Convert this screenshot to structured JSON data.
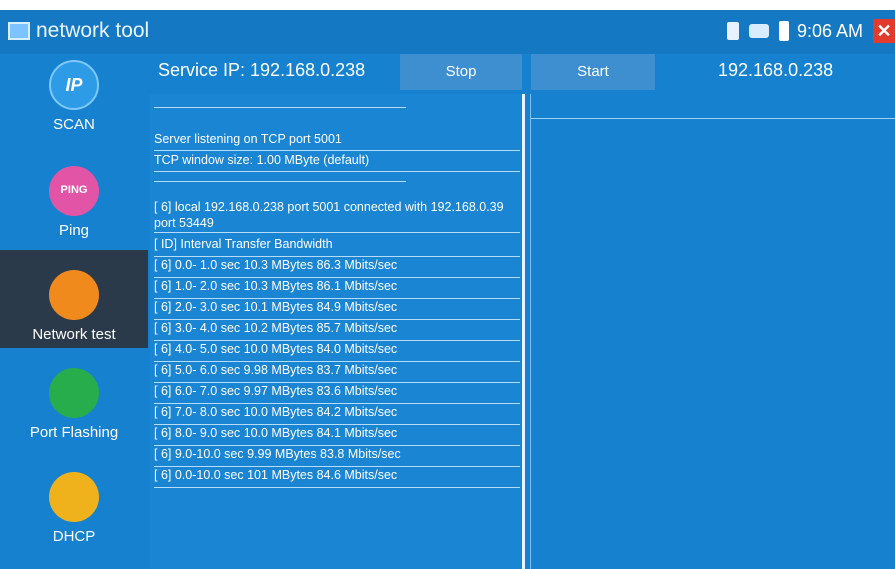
{
  "titlebar": {
    "app_name": "network tool",
    "time": "9:06 AM",
    "close_glyph": "✕",
    "icons": [
      "sim-card-icon",
      "network-icon",
      "battery-icon",
      "close-icon"
    ]
  },
  "sidebar": {
    "items": [
      {
        "label": "SCAN",
        "icon": "ip-scan-icon",
        "glyph": "IP"
      },
      {
        "label": "Ping",
        "icon": "ping-icon",
        "glyph": "PING"
      },
      {
        "label": "Network test",
        "icon": "network-test-icon",
        "glyph": ""
      },
      {
        "label": "Port Flashing",
        "icon": "port-flashing-icon",
        "glyph": ""
      },
      {
        "label": "DHCP",
        "icon": "dhcp-icon",
        "glyph": ""
      }
    ],
    "active": "Network test"
  },
  "header": {
    "service_ip": "Service IP: 192.168.0.238",
    "stop_label": "Stop",
    "start_label": "Start",
    "server_ip": "192.168.0.238"
  },
  "log": {
    "lines": [
      "Server listening on TCP port 5001",
      "TCP window size: 1.00 MByte (default)",
      "[ 6] local 192.168.0.238 port 5001 connected with 192.168.0.39 port 53449",
      "[ ID] Interval      Transfer    Bandwidth",
      "[ 6]  0.0- 1.0 sec  10.3 MBytes  86.3 Mbits/sec",
      "[ 6]  1.0- 2.0 sec  10.3 MBytes  86.1 Mbits/sec",
      "[ 6]  2.0- 3.0 sec  10.1 MBytes  84.9 Mbits/sec",
      "[ 6]  3.0- 4.0 sec  10.2 MBytes  85.7 Mbits/sec",
      "[ 6]  4.0- 5.0 sec  10.0 MBytes  84.0 Mbits/sec",
      "[ 6]  5.0- 6.0 sec  9.98 MBytes  83.7 Mbits/sec",
      "[ 6]  6.0- 7.0 sec  9.97 MBytes  83.6 Mbits/sec",
      "[ 6]  7.0- 8.0 sec  10.0 MBytes  84.2 Mbits/sec",
      "[ 6]  8.0- 9.0 sec  10.0 MBytes  84.1 Mbits/sec",
      "[ 6]  9.0-10.0 sec  9.99 MBytes  83.8 Mbits/sec",
      "[ 6]  0.0-10.0 sec  101 MBytes  84.6 Mbits/sec"
    ]
  },
  "colors": {
    "background": "#1682cf",
    "titlebar": "#1478c2",
    "active_nav": "#2b3a4a",
    "button": "#3d8fcf",
    "close": "#e23b2e"
  }
}
